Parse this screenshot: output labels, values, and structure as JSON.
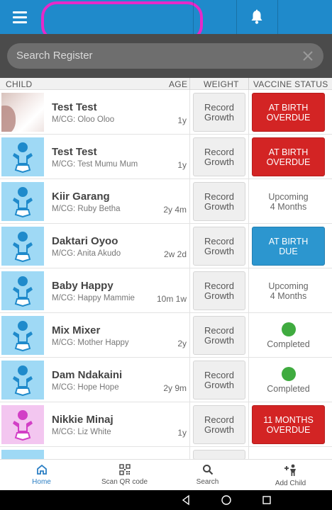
{
  "search": {
    "placeholder": "Search Register"
  },
  "columns": {
    "child": "CHILD",
    "age": "AGE",
    "weight": "WEIGHT",
    "vaccine_status": "VACCINE STATUS"
  },
  "rows": [
    {
      "name": "Test Test",
      "caregiver": "M/CG: Oloo Oloo",
      "age": "1y",
      "weight_label": "Record\nGrowth",
      "status_text": "AT BIRTH\nOVERDUE",
      "status_kind": "overdue",
      "avatar": "photo"
    },
    {
      "name": "Test Test",
      "caregiver": "M/CG: Test Mumu Mum",
      "age": "1y",
      "weight_label": "Record\nGrowth",
      "status_text": "AT BIRTH\nOVERDUE",
      "status_kind": "overdue",
      "avatar": "baby-boy-icon"
    },
    {
      "name": "Kiir Garang",
      "caregiver": "M/CG: Ruby Betha",
      "age": "2y 4m",
      "weight_label": "Record\nGrowth",
      "status_text": "Upcoming\n4 Months",
      "status_kind": "upcoming",
      "avatar": "baby-boy-icon"
    },
    {
      "name": "Daktari Oyoo",
      "caregiver": "M/CG: Anita Akudo",
      "age": "2w 2d",
      "weight_label": "Record\nGrowth",
      "status_text": "AT BIRTH\nDUE",
      "status_kind": "due",
      "avatar": "baby-boy-icon"
    },
    {
      "name": "Baby Happy",
      "caregiver": "M/CG: Happy Mammie",
      "age": "10m 1w",
      "weight_label": "Record\nGrowth",
      "status_text": "Upcoming\n4 Months",
      "status_kind": "upcoming",
      "avatar": "baby-boy-icon"
    },
    {
      "name": "Mix Mixer",
      "caregiver": "M/CG: Mother Happy",
      "age": "2y",
      "weight_label": "Record\nGrowth",
      "status_text": "Completed",
      "status_kind": "completed",
      "avatar": "baby-boy-icon"
    },
    {
      "name": "Dam Ndakaini",
      "caregiver": "M/CG: Hope Hope",
      "age": "2y 9m",
      "weight_label": "Record\nGrowth",
      "status_text": "Completed",
      "status_kind": "completed",
      "avatar": "baby-boy-icon"
    },
    {
      "name": "Nikkie Minaj",
      "caregiver": "M/CG: Liz White",
      "age": "1y",
      "weight_label": "Record\nGrowth",
      "status_text": "11 MONTHS\nOVERDUE",
      "status_kind": "overdue",
      "avatar": "baby-girl-icon"
    }
  ],
  "bottom_nav": {
    "home": "Home",
    "scan_qr": "Scan QR code",
    "search": "Search",
    "add_child": "Add Child"
  },
  "colors": {
    "primary": "#1f8acb",
    "overdue": "#d32424",
    "due": "#2c96cf",
    "completed": "#3fab3f",
    "avatar_boy": "#9fd9f5",
    "avatar_girl": "#f3c6f0",
    "highlight": "#e629c9"
  }
}
